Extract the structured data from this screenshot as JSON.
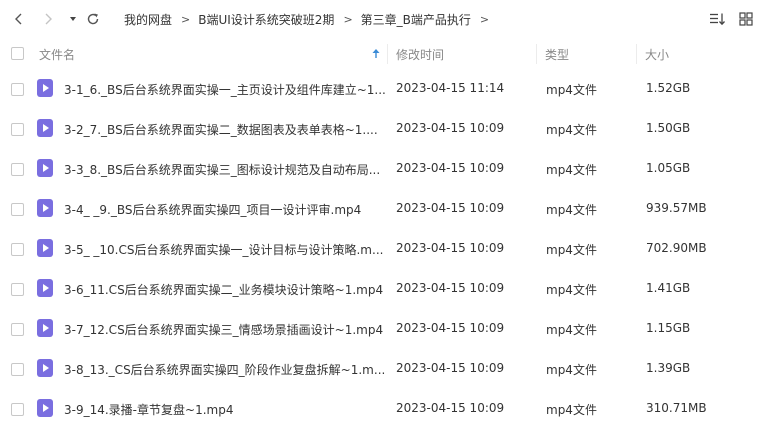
{
  "icons": {
    "back": "chevron-left-icon",
    "forward": "chevron-right-icon",
    "history": "caret-down-icon",
    "refresh": "refresh-icon",
    "sort": "sort-icon",
    "view": "grid-view-icon",
    "file": "video-file-icon",
    "sort_arrow": "arrow-up-icon"
  },
  "colors": {
    "file_icon": "#7a6ee0",
    "sort_arrow": "#3b8bd6"
  },
  "breadcrumb": {
    "items": [
      "我的网盘",
      "B端UI设计系统突破班2期",
      "第三章_B端产品执行"
    ],
    "separator": ">"
  },
  "columns": {
    "name": "文件名",
    "modified": "修改时间",
    "type": "类型",
    "size": "大小"
  },
  "files": [
    {
      "name": "3-1_6._BS后台系统界面实操一_主页设计及组件库建立~1...",
      "modified": "2023-04-15 11:14",
      "type": "mp4文件",
      "size": "1.52GB"
    },
    {
      "name": "3-2_7._BS后台系统界面实操二_数据图表及表单表格~1....",
      "modified": "2023-04-15 10:09",
      "type": "mp4文件",
      "size": "1.50GB"
    },
    {
      "name": "3-3_8._BS后台系统界面实操三_图标设计规范及自动布局...",
      "modified": "2023-04-15 10:09",
      "type": "mp4文件",
      "size": "1.05GB"
    },
    {
      "name": "3-4_ _9._BS后台系统界面实操四_项目一设计评审.mp4",
      "modified": "2023-04-15 10:09",
      "type": "mp4文件",
      "size": "939.57MB"
    },
    {
      "name": "3-5_ _10.CS后台系统界面实操一_设计目标与设计策略.m...",
      "modified": "2023-04-15 10:09",
      "type": "mp4文件",
      "size": "702.90MB"
    },
    {
      "name": "3-6_11.CS后台系统界面实操二_业务模块设计策略~1.mp4",
      "modified": "2023-04-15 10:09",
      "type": "mp4文件",
      "size": "1.41GB"
    },
    {
      "name": "3-7_12.CS后台系统界面实操三_情感场景插画设计~1.mp4",
      "modified": "2023-04-15 10:09",
      "type": "mp4文件",
      "size": "1.15GB"
    },
    {
      "name": "3-8_13._CS后台系统界面实操四_阶段作业复盘拆解~1.m...",
      "modified": "2023-04-15 10:09",
      "type": "mp4文件",
      "size": "1.39GB"
    },
    {
      "name": "3-9_14.录播-章节复盘~1.mp4",
      "modified": "2023-04-15 10:09",
      "type": "mp4文件",
      "size": "310.71MB"
    }
  ]
}
